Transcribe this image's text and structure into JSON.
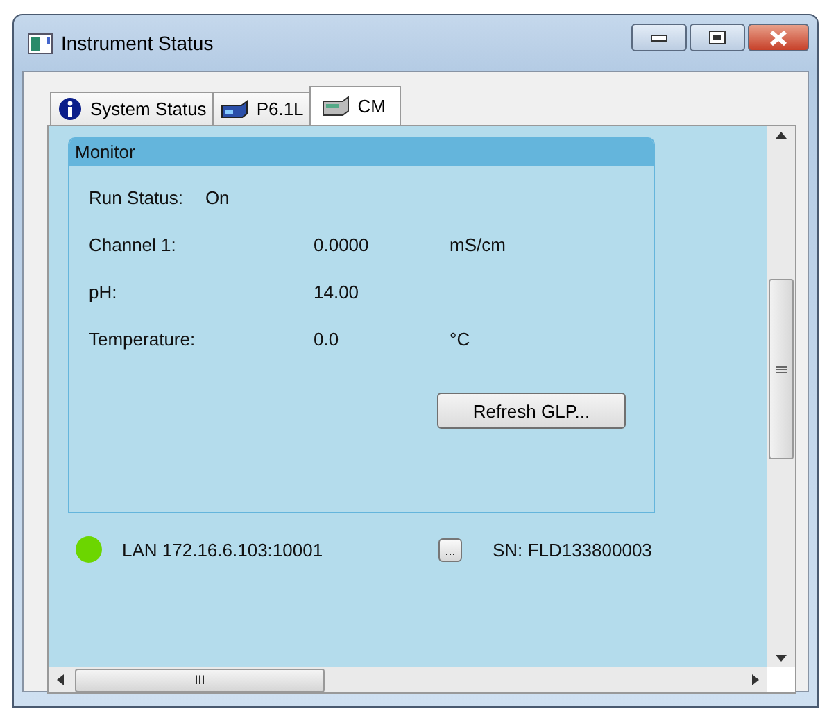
{
  "window": {
    "title": "Instrument Status"
  },
  "tabs": [
    {
      "label": "System Status",
      "kind": "info",
      "selected": false
    },
    {
      "label": "P6.1L",
      "kind": "pump",
      "selected": false
    },
    {
      "label": "CM",
      "kind": "detector",
      "selected": true
    }
  ],
  "monitor": {
    "title": "Monitor",
    "run_status": {
      "label": "Run Status:",
      "value": "On"
    },
    "readings": [
      {
        "label": "Channel 1:",
        "value": "0.0000",
        "unit": "mS/cm"
      },
      {
        "label": "pH:",
        "value": "14.00"
      },
      {
        "label": "Temperature:",
        "value": "0.0",
        "unit": "°C"
      }
    ],
    "button": "Refresh GLP..."
  },
  "connection": {
    "label": "LAN 172.16.6.103:10001",
    "connected": true,
    "browse_button": "...",
    "serial": "SN: FLD133800003"
  },
  "scrollbar": {
    "thumb_label": "III"
  }
}
